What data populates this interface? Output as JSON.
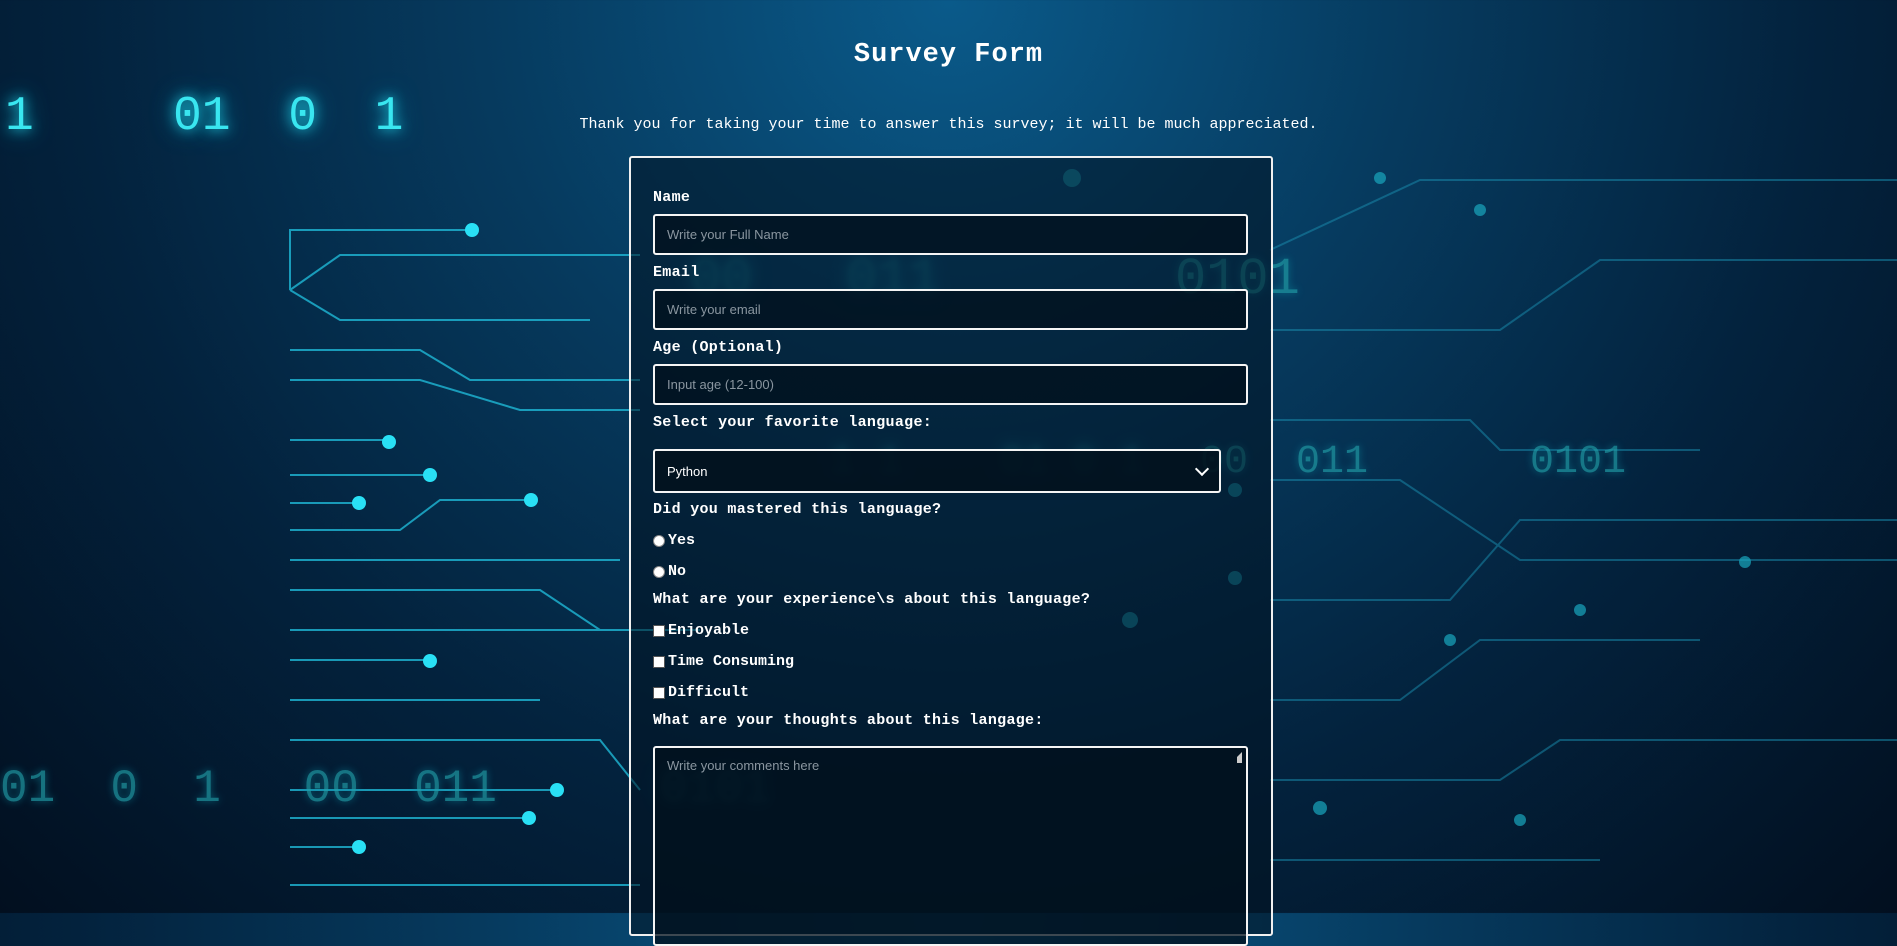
{
  "background": {
    "binary_strings": [
      "1",
      "01  0  1",
      "00   011",
      "0101",
      "1 1",
      "01 0 1",
      "00  011",
      "0101",
      "01  0  1   00  011",
      "0101"
    ]
  },
  "page": {
    "title": "Survey Form",
    "description": "Thank you for taking your time to answer this survey; it will be much appreciated."
  },
  "form": {
    "name_label": "Name",
    "name_placeholder": "Write your Full Name",
    "email_label": "Email",
    "email_placeholder": "Write your email",
    "age_label": "Age (Optional)",
    "age_placeholder": "Input age (12-100)",
    "language_label": "Select your favorite language:",
    "language_selected": "Python",
    "mastered_label": "Did you mastered this language?",
    "mastered_options": [
      "Yes",
      "No"
    ],
    "experience_label": "What are your experience\\s about this language?",
    "experience_options": [
      "Enjoyable",
      "Time Consuming",
      "Difficult"
    ],
    "thoughts_label": "What are your thoughts about this langage:",
    "thoughts_placeholder": "Write your comments here"
  },
  "colors": {
    "accent": "#39e6f0",
    "background": "#03223d",
    "border": "#f0f0f0"
  }
}
